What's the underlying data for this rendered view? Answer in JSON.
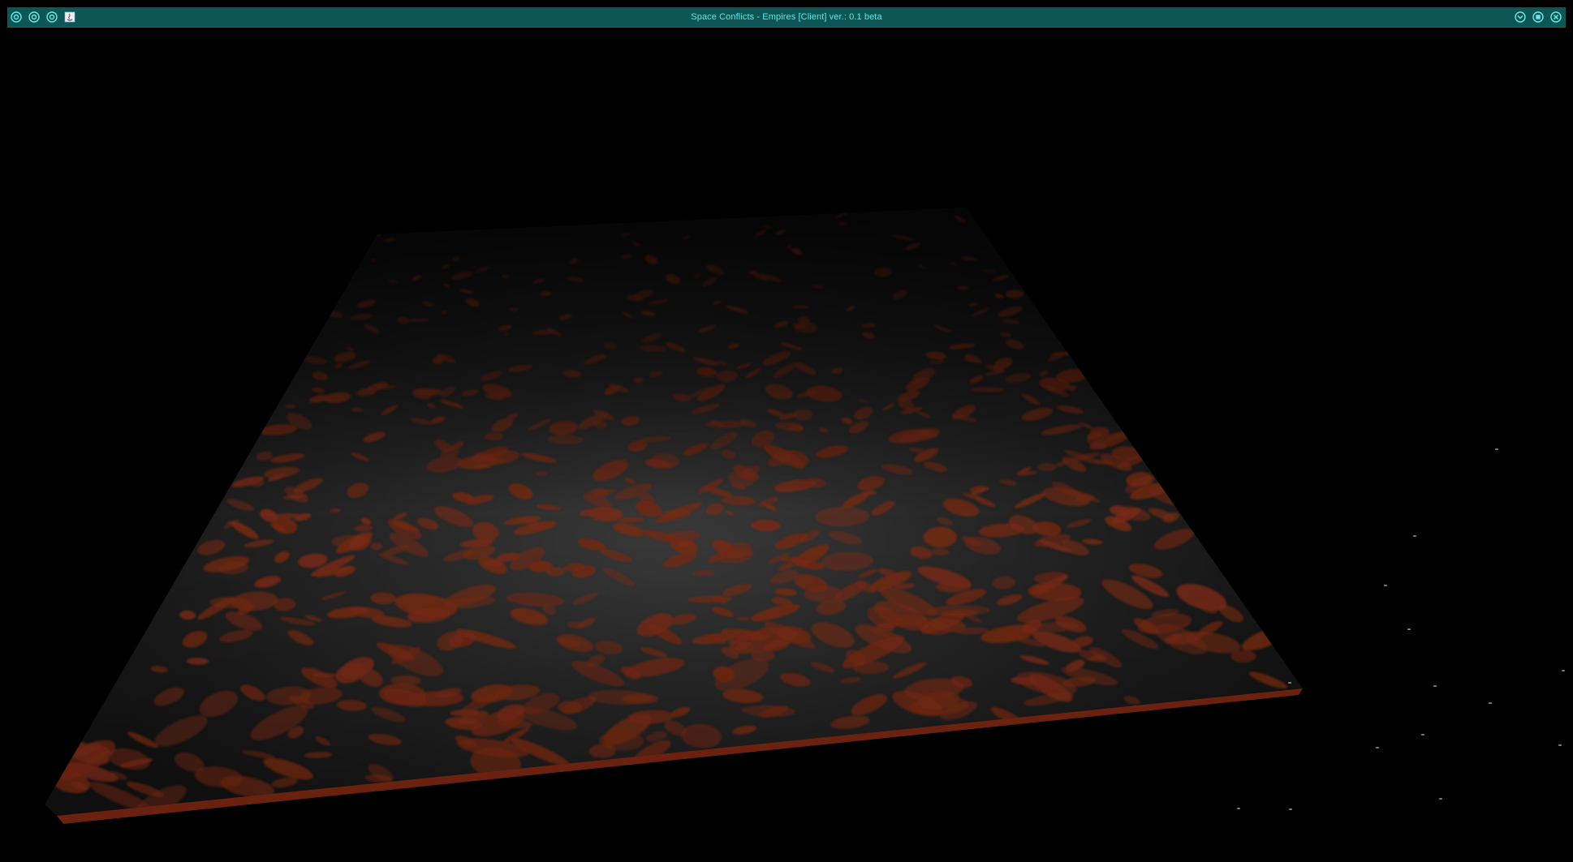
{
  "window": {
    "title": "Space Conflicts - Empires [Client] ver.: 0.1 beta",
    "left_buttons": [
      {
        "name": "system-button-1",
        "icon": "circle-target-icon"
      },
      {
        "name": "system-button-2",
        "icon": "circle-target-icon"
      },
      {
        "name": "system-button-3",
        "icon": "circle-target-icon"
      },
      {
        "name": "app-icon-button",
        "icon": "java-app-icon"
      }
    ],
    "right_buttons": [
      {
        "name": "minimize-button",
        "icon": "chevron-down-circle-icon"
      },
      {
        "name": "maximize-button",
        "icon": "square-circle-icon"
      },
      {
        "name": "close-button",
        "icon": "x-circle-icon"
      }
    ]
  },
  "scene": {
    "type": "3d-terrain-map",
    "terrain_color": "#1c1c1c",
    "lava_color": "#7a2a14",
    "edge_color": "#8a2c14",
    "background": "#000000",
    "accent": "#0d5655",
    "title_color": "#5fe6e6"
  }
}
